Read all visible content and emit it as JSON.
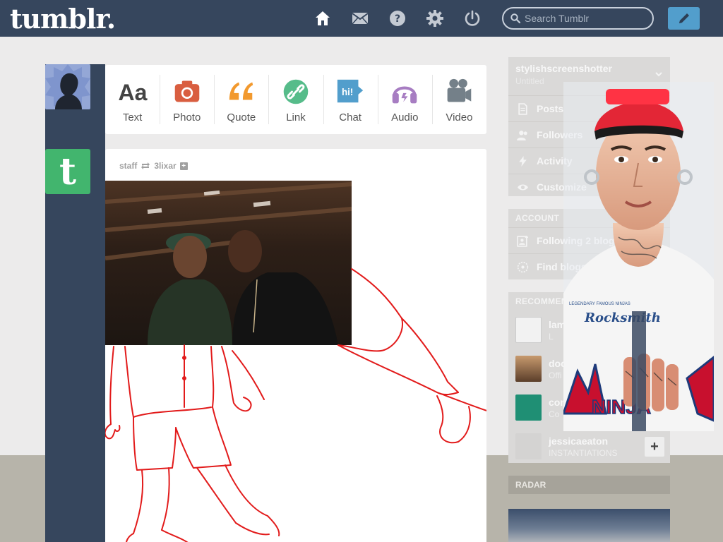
{
  "brand": {
    "logo_text": "tumblr."
  },
  "search": {
    "placeholder": "Search Tumblr"
  },
  "nav": {
    "icons": [
      "home-icon",
      "mail-icon",
      "help-icon",
      "settings-icon",
      "power-icon",
      "pencil-icon"
    ]
  },
  "post_types": [
    {
      "label": "Text",
      "icon": "text-aa-icon",
      "color": "#444444"
    },
    {
      "label": "Photo",
      "icon": "camera-icon",
      "color": "#d95e40"
    },
    {
      "label": "Quote",
      "icon": "quote-icon",
      "color": "#f2992e"
    },
    {
      "label": "Link",
      "icon": "link-icon",
      "color": "#56bc8a"
    },
    {
      "label": "Chat",
      "icon": "chat-icon",
      "color": "#529ecc",
      "glyph": "hi!"
    },
    {
      "label": "Audio",
      "icon": "headphones-icon",
      "color": "#a77dc2"
    },
    {
      "label": "Video",
      "icon": "video-camera-icon",
      "color": "#748089"
    }
  ],
  "post": {
    "author": "staff",
    "reblogged_from": "3lixar",
    "plus_glyph": "+"
  },
  "avatar": {
    "tumblr_glyph": "t"
  },
  "sidebar": {
    "blog": {
      "name": "stylishscreenshotter",
      "title": "Untitled"
    },
    "blog_menu": [
      {
        "label": "Posts",
        "icon": "document-icon"
      },
      {
        "label": "Followers",
        "icon": "people-icon"
      },
      {
        "label": "Activity",
        "icon": "lightning-icon"
      },
      {
        "label": "Customize",
        "icon": "eye-icon"
      }
    ],
    "account_heading": "ACCOUNT",
    "account_menu": [
      {
        "label": "Following 2 blogs",
        "icon": "add-person-icon"
      },
      {
        "label": "Find blogs",
        "icon": "compass-icon"
      }
    ],
    "recommended_heading": "RECOMMENDED BLOGS",
    "recommended": [
      {
        "name": "lam",
        "sub": "L",
        "avatar_color": "#f2f2f2"
      },
      {
        "name": "doc",
        "sub": "Offi",
        "avatar_color": "#8a6a4a"
      },
      {
        "name": "com",
        "sub": "Co",
        "avatar_color": "#1f8f74"
      },
      {
        "name": "jessicaeaton",
        "sub": "INSTANTIATIONS",
        "avatar_color": "#d4d3d2"
      }
    ],
    "follow_glyph": "+",
    "radar_heading": "RADAR"
  },
  "overlay": {
    "cap_text": "LEGENDARY FAMOUS NINJAS",
    "shirt_brand": "Rocksmith",
    "jersey_text": "NINJA"
  }
}
